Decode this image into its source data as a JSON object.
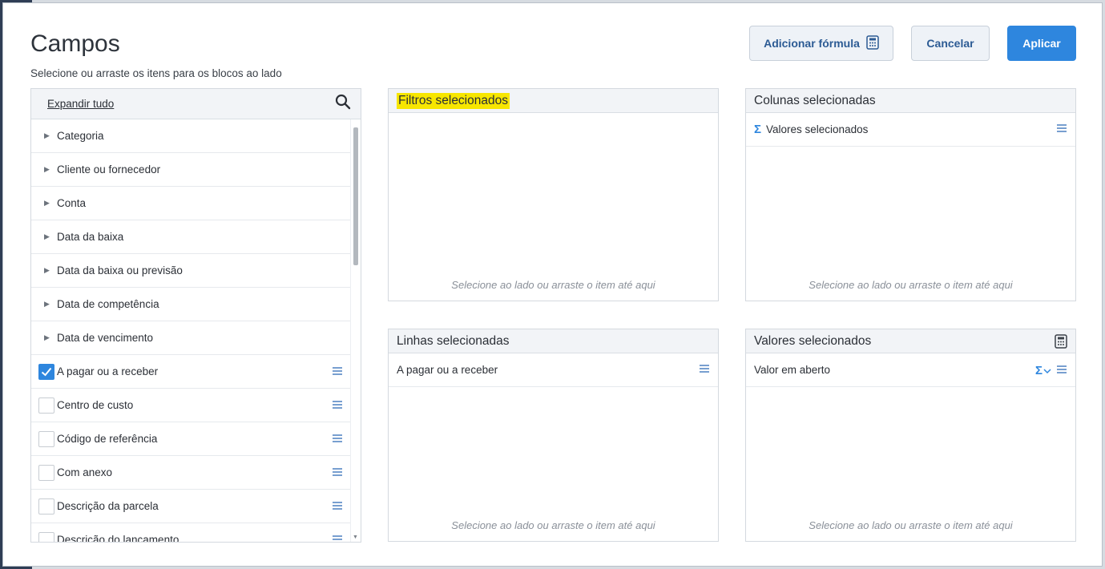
{
  "dialog": {
    "title": "Campos",
    "subtitle": "Selecione ou arraste os itens para os blocos ao lado"
  },
  "toolbar": {
    "formula_label": "Adicionar fórmula",
    "cancel_label": "Cancelar",
    "apply_label": "Aplicar"
  },
  "fields": {
    "expand_label": "Expandir tudo",
    "groups": [
      {
        "label": "Categoria"
      },
      {
        "label": "Cliente ou fornecedor"
      },
      {
        "label": "Conta"
      },
      {
        "label": "Data da baixa"
      },
      {
        "label": "Data da baixa ou previsão"
      },
      {
        "label": "Data de competência"
      },
      {
        "label": "Data de vencimento"
      }
    ],
    "items": [
      {
        "label": "A pagar ou a receber",
        "checked": true
      },
      {
        "label": "Centro de custo",
        "checked": false
      },
      {
        "label": "Código de referência",
        "checked": false
      },
      {
        "label": "Com anexo",
        "checked": false
      },
      {
        "label": "Descrição da parcela",
        "checked": false
      },
      {
        "label": "Descrição do lançamento",
        "checked": false
      }
    ]
  },
  "boxes": {
    "filters": {
      "title": "Filtros selecionados",
      "placeholder": "Selecione ao lado ou arraste o item até aqui"
    },
    "columns": {
      "title": "Colunas selecionadas",
      "item": "Valores selecionados",
      "placeholder": "Selecione ao lado ou arraste o item até aqui"
    },
    "rows": {
      "title": "Linhas selecionadas",
      "item": "A pagar ou a receber",
      "placeholder": "Selecione ao lado ou arraste o item até aqui"
    },
    "values": {
      "title": "Valores selecionados",
      "item": "Valor em aberto",
      "placeholder": "Selecione ao lado ou arraste o item até aqui"
    }
  },
  "colors": {
    "accent": "#2e86de",
    "highlight": "#f7e600"
  }
}
